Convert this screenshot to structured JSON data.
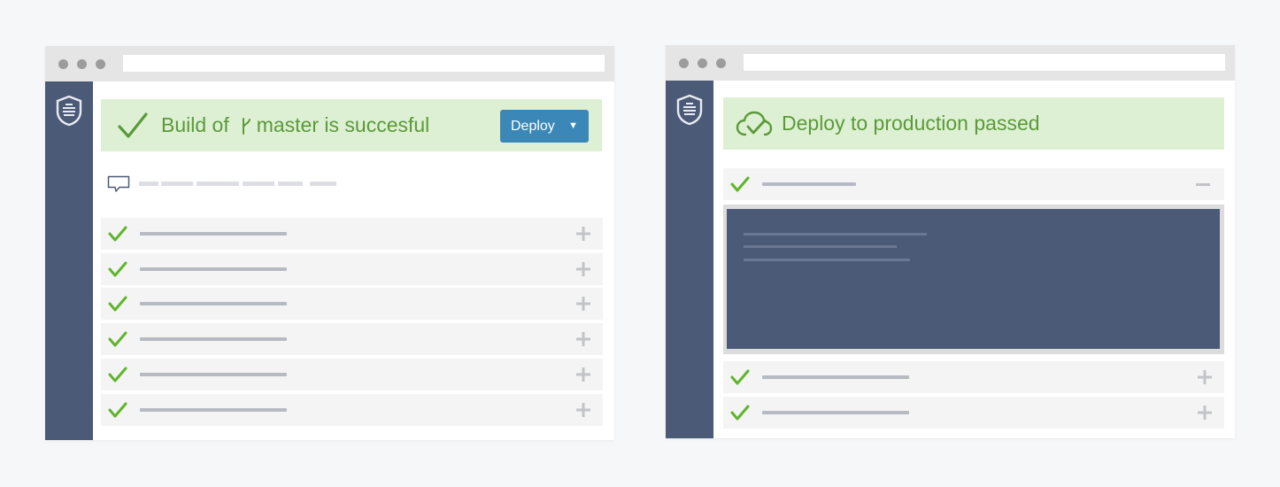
{
  "icons": {
    "logo": "shield-logo-icon",
    "success": "checkmark-icon",
    "branch": "branch-icon",
    "cloud": "cloud-check-icon",
    "comment": "comment-icon",
    "expand": "plus-icon",
    "collapse": "minus-icon",
    "dropdown": "caret-down-icon"
  },
  "colors": {
    "sidebar": "#4b5a76",
    "success_bg": "#def0d3",
    "success_text": "#5a9a3a",
    "check": "#5fb52b",
    "button": "#3a87b8"
  },
  "left_window": {
    "banner": {
      "prefix": "Build of",
      "branch": "master is succesful",
      "deploy_label": "Deploy",
      "caret": "▼"
    }
  },
  "right_window": {
    "banner": {
      "text": "Deploy to production passed"
    }
  }
}
